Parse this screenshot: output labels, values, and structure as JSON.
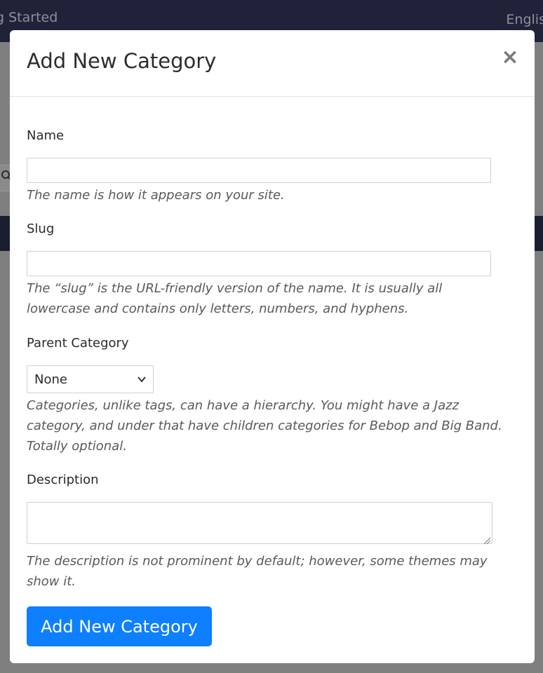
{
  "background": {
    "topbar_left_text": "g Started",
    "topbar_right_text": "Englis",
    "colors": {
      "topbar": "#20223a",
      "overlay": "#7f7f7f"
    }
  },
  "modal": {
    "title": "Add New Category",
    "close_label": "×",
    "fields": {
      "name": {
        "label": "Name",
        "value": "",
        "help": "The name is how it appears on your site."
      },
      "slug": {
        "label": "Slug",
        "value": "",
        "help": "The “slug” is the URL-friendly version of the name. It is usually all lowercase and contains only letters, numbers, and hyphens."
      },
      "parent": {
        "label": "Parent Category",
        "selected": "None",
        "help": "Categories, unlike tags, can have a hierarchy. You might have a Jazz category, and under that have children categories for Bebop and Big Band. Totally optional."
      },
      "description": {
        "label": "Description",
        "value": "",
        "help": "The description is not prominent by default; however, some themes may show it."
      }
    },
    "submit_label": "Add New Category",
    "icons": {
      "close": "close-icon",
      "select": "chevron-down-icon",
      "search": "search-icon"
    },
    "colors": {
      "primary": "#0d7fff"
    }
  }
}
